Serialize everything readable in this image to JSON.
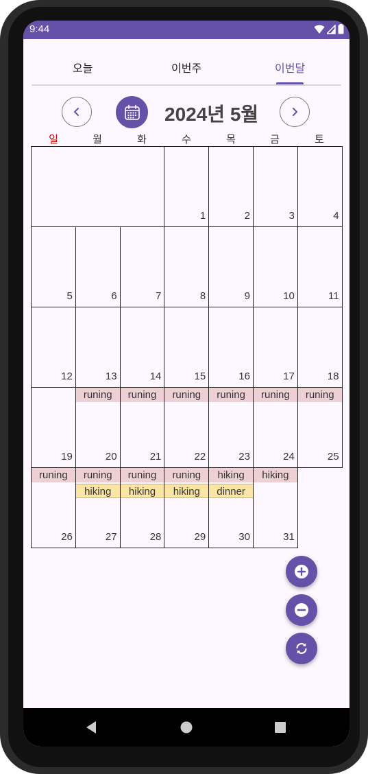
{
  "status_bar": {
    "time": "9:44"
  },
  "tabs": [
    {
      "label": "오늘",
      "active": false
    },
    {
      "label": "이번주",
      "active": false
    },
    {
      "label": "이번달",
      "active": true
    }
  ],
  "header": {
    "title": "2024년 5월",
    "prev_icon": "chevron-left-icon",
    "next_icon": "chevron-right-icon",
    "calendar_icon": "calendar-icon"
  },
  "weekdays": [
    "일",
    "월",
    "화",
    "수",
    "목",
    "금",
    "토"
  ],
  "colors": {
    "accent": "#6551a8",
    "sunday": "#cc0000",
    "event_pink": "#ecd0d4",
    "event_yellow": "#fbe5a5"
  },
  "calendar": {
    "weeks": [
      [
        null,
        null,
        null,
        "1",
        "2",
        "3",
        "4"
      ],
      [
        "5",
        "6",
        "7",
        "8",
        "9",
        "10",
        "11"
      ],
      [
        "12",
        "13",
        "14",
        "15",
        "16",
        "17",
        "18"
      ],
      [
        "19",
        "20",
        "21",
        "22",
        "23",
        "24",
        "25"
      ],
      [
        "26",
        "27",
        "28",
        "29",
        "30",
        "31",
        null
      ]
    ],
    "events": {
      "20": [
        {
          "label": "runing",
          "color": "pink"
        }
      ],
      "21": [
        {
          "label": "runing",
          "color": "pink"
        }
      ],
      "22": [
        {
          "label": "runing",
          "color": "pink"
        }
      ],
      "23": [
        {
          "label": "runing",
          "color": "pink"
        }
      ],
      "24": [
        {
          "label": "runing",
          "color": "pink"
        }
      ],
      "25": [
        {
          "label": "runing",
          "color": "pink"
        }
      ],
      "26": [
        {
          "label": "runing",
          "color": "pink"
        }
      ],
      "27": [
        {
          "label": "runing",
          "color": "pink"
        },
        {
          "label": "hiking",
          "color": "yellow"
        }
      ],
      "28": [
        {
          "label": "runing",
          "color": "pink"
        },
        {
          "label": "hiking",
          "color": "yellow"
        }
      ],
      "29": [
        {
          "label": "runing",
          "color": "pink"
        },
        {
          "label": "hiking",
          "color": "yellow"
        }
      ],
      "30": [
        {
          "label": "hiking",
          "color": "pink"
        },
        {
          "label": "dinner",
          "color": "yellow"
        }
      ],
      "31": [
        {
          "label": "hiking",
          "color": "pink"
        }
      ]
    }
  },
  "fabs": [
    {
      "name": "add-button",
      "icon": "plus-circle-icon"
    },
    {
      "name": "remove-button",
      "icon": "minus-circle-icon"
    },
    {
      "name": "refresh-button",
      "icon": "refresh-icon"
    }
  ],
  "nav_bar": [
    "back-icon",
    "home-icon",
    "recents-icon"
  ]
}
